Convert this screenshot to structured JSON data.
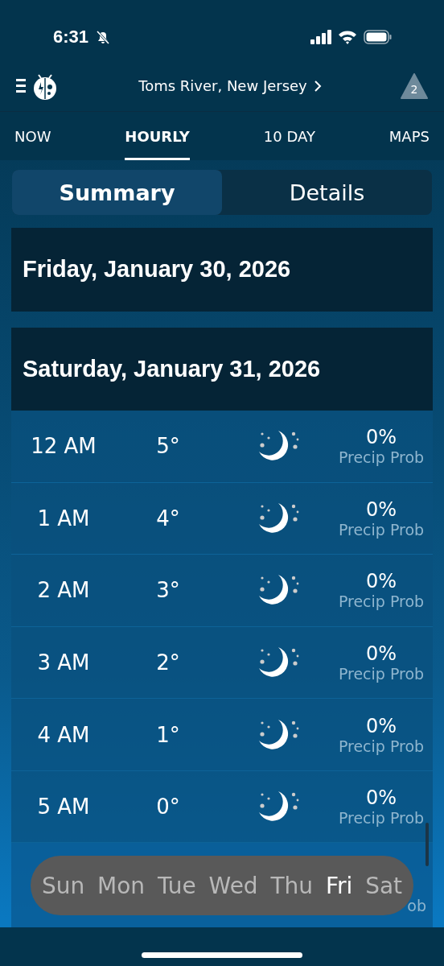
{
  "status_bar": {
    "time": "6:31",
    "silent": true
  },
  "header": {
    "location": "Toms River, New Jersey",
    "alerts": "2"
  },
  "tabs": [
    {
      "label": "NOW",
      "selected": false
    },
    {
      "label": "HOURLY",
      "selected": true
    },
    {
      "label": "10 DAY",
      "selected": false
    },
    {
      "label": "MAPS",
      "selected": false
    }
  ],
  "segments": [
    {
      "label": "Summary",
      "selected": true
    },
    {
      "label": "Details",
      "selected": false
    }
  ],
  "days": [
    {
      "title": "Friday, January 30, 2026"
    },
    {
      "title": "Saturday, January 31, 2026",
      "hours": [
        {
          "time": "12 AM",
          "temp": "5°",
          "precip": "0%",
          "precip_label": "Precip Prob"
        },
        {
          "time": "1 AM",
          "temp": "4°",
          "precip": "0%",
          "precip_label": "Precip Prob"
        },
        {
          "time": "2 AM",
          "temp": "3°",
          "precip": "0%",
          "precip_label": "Precip Prob"
        },
        {
          "time": "3 AM",
          "temp": "2°",
          "precip": "0%",
          "precip_label": "Precip Prob"
        },
        {
          "time": "4 AM",
          "temp": "1°",
          "precip": "0%",
          "precip_label": "Precip Prob"
        },
        {
          "time": "5 AM",
          "temp": "0°",
          "precip": "0%",
          "precip_label": "Precip Prob"
        }
      ],
      "covered_row_label": "ob"
    }
  ],
  "day_picker": [
    {
      "label": "Sun",
      "selected": false
    },
    {
      "label": "Mon",
      "selected": false
    },
    {
      "label": "Tue",
      "selected": false
    },
    {
      "label": "Wed",
      "selected": false
    },
    {
      "label": "Thu",
      "selected": false
    },
    {
      "label": "Fri",
      "selected": true
    },
    {
      "label": "Sat",
      "selected": false
    }
  ]
}
